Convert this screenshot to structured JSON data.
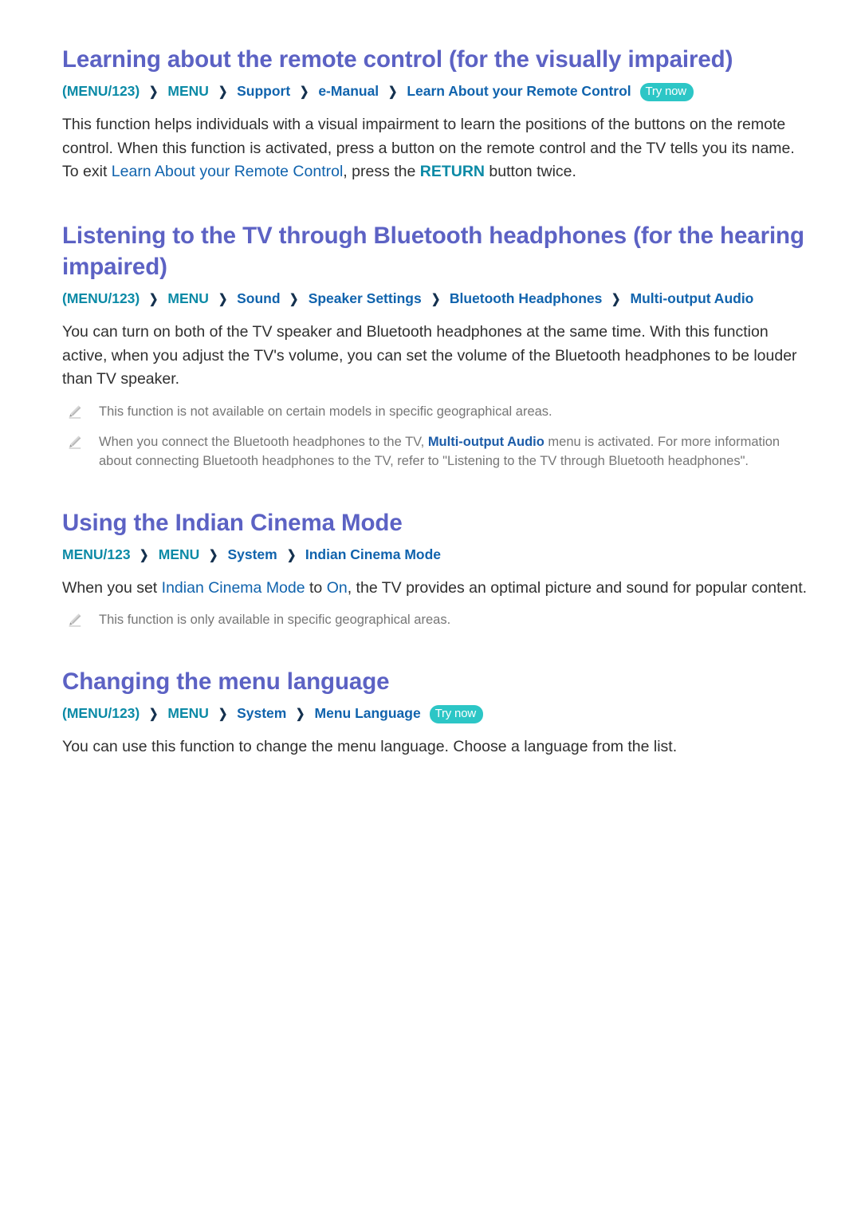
{
  "colors": {
    "heading": "#5c62c4",
    "path_teal": "#0b8aa6",
    "path_blue": "#1063ad",
    "chevron": "#14314f",
    "badge_bg": "#2cc6c6",
    "body_text": "#2f2f2f",
    "note_text": "#767676"
  },
  "sections": [
    {
      "title": "Learning about the remote control (for the visually impaired)",
      "path": {
        "root": "(MENU/123)",
        "menu": "MENU",
        "crumb3": "Support",
        "crumb4": "e-Manual",
        "crumb5": "Learn About your Remote Control",
        "try_now": "Try now"
      },
      "body": {
        "p1_a": "This function helps individuals with a visual impairment to learn the positions of the buttons on the remote control. When this function is activated, press a button on the remote control and the TV tells you its name. To exit ",
        "p1_link": "Learn About your Remote Control",
        "p1_b": ", press the ",
        "p1_key": "RETURN",
        "p1_c": " button twice."
      }
    },
    {
      "title": "Listening to the TV through Bluetooth headphones (for the hearing impaired)",
      "path": {
        "root": "(MENU/123)",
        "menu": "MENU",
        "crumb3": "Sound",
        "crumb4": "Speaker Settings",
        "crumb5": "Bluetooth Headphones",
        "crumb6": "Multi-output Audio"
      },
      "body": {
        "p1": "You can turn on both of the TV speaker and Bluetooth headphones at the same time. With this function active, when you adjust the TV's volume, you can set the volume of the Bluetooth headphones to be louder than TV speaker."
      },
      "notes": [
        {
          "icon": "pencil-icon",
          "text": "This function is not available on certain models in specific geographical areas."
        },
        {
          "icon": "pencil-icon",
          "text_a": "When you connect the Bluetooth headphones to the TV, ",
          "link": "Multi-output Audio",
          "text_b": " menu is activated. For more information about connecting Bluetooth headphones to the TV, refer to \"Listening to the TV through Bluetooth headphones\"."
        }
      ]
    },
    {
      "title": "Using the Indian Cinema Mode",
      "path": {
        "root": "MENU/123",
        "menu": "MENU",
        "crumb3": "System",
        "crumb4": "Indian Cinema Mode"
      },
      "body": {
        "p1_a": "When you set ",
        "p1_link1": "Indian Cinema Mode",
        "p1_b": " to ",
        "p1_link2": "On",
        "p1_c": ", the TV provides an optimal picture and sound for popular content."
      },
      "notes": [
        {
          "icon": "pencil-icon",
          "text": "This function is only available in specific geographical areas."
        }
      ]
    },
    {
      "title": "Changing the menu language",
      "path": {
        "root": "(MENU/123)",
        "menu": "MENU",
        "crumb3": "System",
        "crumb4": "Menu Language",
        "try_now": "Try now"
      },
      "body": {
        "p1": "You can use this function to change the menu language. Choose a language from the list."
      }
    }
  ],
  "glyphs": {
    "chevron": "❯"
  }
}
